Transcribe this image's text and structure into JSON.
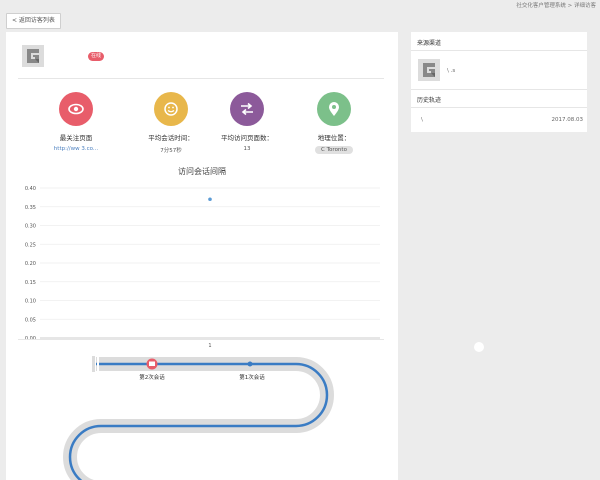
{
  "header": {
    "breadcrumb": "社交化客户管理系统 > 详细访客",
    "back_label": "< 返回访客列表"
  },
  "visitor": {
    "name": "",
    "badge": "在线"
  },
  "stats": [
    {
      "label": "最关注页面",
      "value": "http://ww            3.co...",
      "color": "#e85d6a",
      "icon": "eye-icon"
    },
    {
      "label": "平均会话时间：",
      "value": "7分57秒",
      "color": "#e8b74b",
      "icon": "smile-icon"
    },
    {
      "label": "平均访问页面数：",
      "value": "13",
      "color": "#8c5a9a",
      "icon": "arrows-icon"
    },
    {
      "label": "地理位置：",
      "value": "C               Toronto",
      "color": "#7cc08a",
      "icon": "location-icon"
    }
  ],
  "chart_title": "访问会话间隔",
  "chart_data": {
    "type": "scatter",
    "title": "访问会话间隔",
    "xlabel": "",
    "ylabel": "",
    "y_ticks": [
      "0.40",
      "0.35",
      "0.30",
      "0.25",
      "0.20",
      "0.15",
      "0.10",
      "0.05",
      "0.00"
    ],
    "x_ticks": [
      "1"
    ],
    "ylim": [
      0,
      0.4
    ],
    "grid": true,
    "points": [
      {
        "x": 1,
        "y": 0.37
      }
    ]
  },
  "timeline": {
    "sessions": [
      "第2次会话",
      "第1次会话"
    ]
  },
  "sidebar": {
    "source_title": "来源渠道",
    "source_text": "\\              .s",
    "history_title": "历史轨迹",
    "history_text": "\\",
    "history_date": "2017.08.03"
  },
  "colors": {
    "accent_blue": "#3a7cc4",
    "track_gray": "#dcdcdc"
  }
}
